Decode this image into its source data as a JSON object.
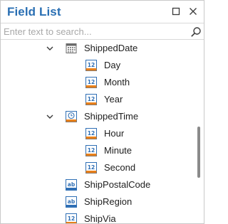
{
  "panel": {
    "title": "Field List",
    "search_placeholder": "Enter text to search...",
    "icons": {
      "maximize": "maximize-icon",
      "close": "close-icon",
      "search": "search-icon"
    }
  },
  "tree": {
    "items": [
      {
        "label": "ShippedDate",
        "type": "date",
        "expanded": true
      },
      {
        "label": "Day",
        "type": "number"
      },
      {
        "label": "Month",
        "type": "number"
      },
      {
        "label": "Year",
        "type": "number"
      },
      {
        "label": "ShippedTime",
        "type": "time",
        "expanded": true
      },
      {
        "label": "Hour",
        "type": "number"
      },
      {
        "label": "Minute",
        "type": "number"
      },
      {
        "label": "Second",
        "type": "number"
      },
      {
        "label": "ShipPostalCode",
        "type": "string"
      },
      {
        "label": "ShipRegion",
        "type": "string"
      },
      {
        "label": "ShipVia",
        "type": "number"
      }
    ]
  },
  "colors": {
    "title": "#2a6fb3",
    "icon_orange": "#e8801a",
    "icon_blue": "#2f6fb5"
  }
}
